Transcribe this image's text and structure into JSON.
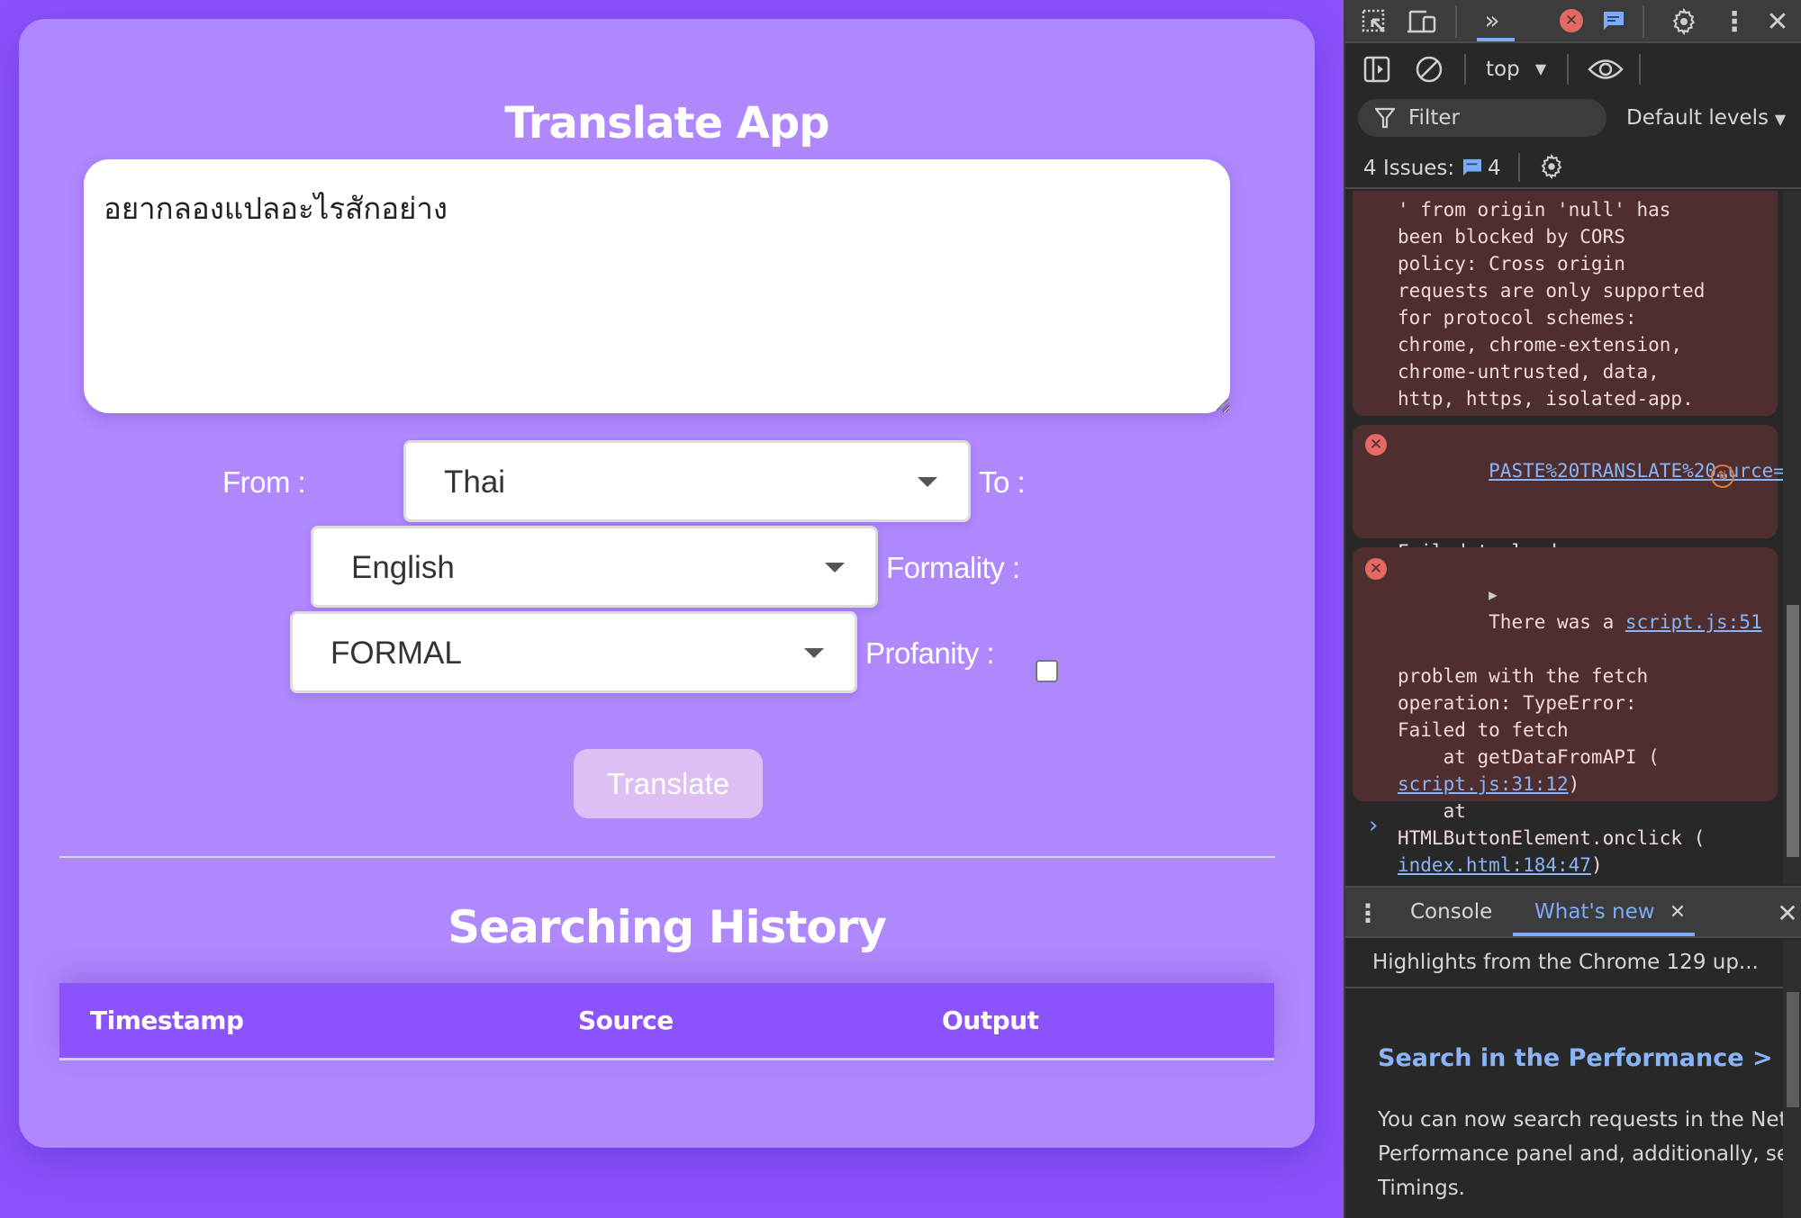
{
  "app": {
    "title": "Translate App",
    "source_text": "อยากลองแปลอะไรสักอย่าง",
    "from_label": "From :",
    "from_value": "Thai",
    "to_label": "To :",
    "to_value": "English",
    "formality_label": "Formality :",
    "formality_value": "FORMAL",
    "profanity_label": "Profanity :",
    "profanity_checked": false,
    "translate_button": "Translate",
    "history_title": "Searching History",
    "history_columns": [
      "Timestamp",
      "Source",
      "Output"
    ],
    "history_rows": []
  },
  "colors": {
    "page_bg": "#8b52fb",
    "card_bg": "#b088fd",
    "table_header_bg": "#8c52fc",
    "button_bg": "#ddbff3"
  },
  "devtools": {
    "top_icons": [
      "inspect-element-icon",
      "device-toolbar-icon",
      "more-tabs-icon",
      "error-status-icon",
      "message-status-icon",
      "settings-icon",
      "more-options-icon",
      "close-icon"
    ],
    "context": "top",
    "filter_placeholder": "Filter",
    "levels": "Default levels",
    "issues_label": "4 Issues:",
    "issues_count": "4",
    "messages": [
      {
        "type": "error",
        "text": "' from origin 'null' has\nbeen blocked by CORS\npolicy: Cross origin\nrequests are only supported\nfor protocol schemes:\nchrome, chrome-extension,\nchrome-untrusted, data,\nhttp, https, isolated-app."
      },
      {
        "type": "error",
        "link": "PASTE%20TRANSLATE%20…urce=…",
        "text": "Failed to load resource:\nnet::ERR_FAILED"
      },
      {
        "type": "error",
        "first_line": "There was a ",
        "source_link": "script.js:51",
        "text_a": "problem with the fetch\noperation: TypeError:\nFailed to fetch\n    at getDataFromAPI (",
        "link_a": "script.js:31:12",
        "text_b": "    at\nHTMLButtonElement.onclick (",
        "link_b": "index.html:184:47"
      }
    ],
    "drawer": {
      "tabs": [
        "Console",
        "What's new"
      ],
      "active_tab": "What's new",
      "title": "Highlights from the Chrome 129 up...",
      "heading": "Search in the Performance > Net",
      "body": [
        "You can now search requests in the Netw",
        "Performance panel and, additionally, see",
        "Timings."
      ]
    }
  }
}
